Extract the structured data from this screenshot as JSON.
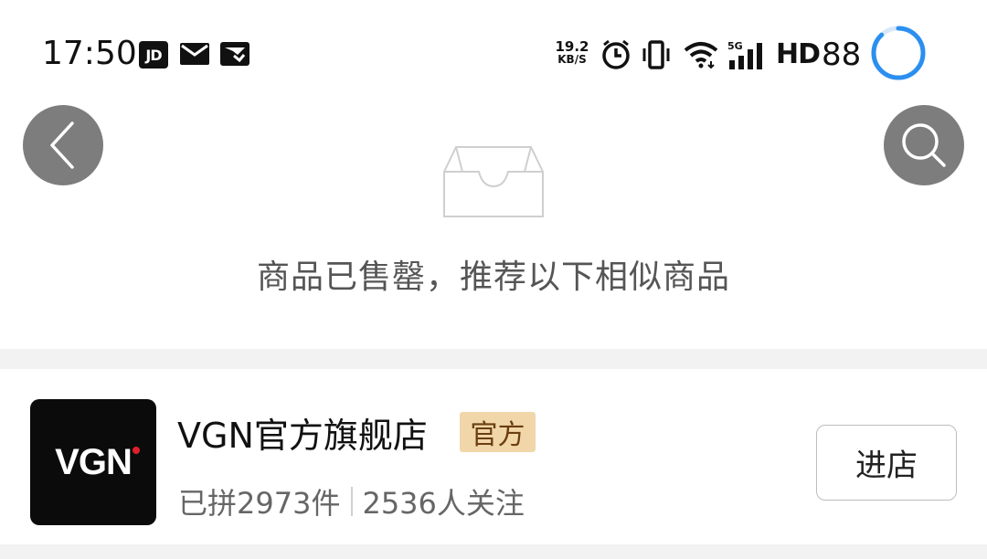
{
  "status_bar": {
    "time": "17:50",
    "jd_label": "JD",
    "net_speed_value": "19.2",
    "net_speed_unit": "KB/S",
    "network_type": "5G",
    "hd_label": "HD",
    "battery_level": "88",
    "battery_ring_fraction": 0.88,
    "icons": [
      "jd-app-icon",
      "mail-icon",
      "payment-icon",
      "alarm-icon",
      "vibrate-icon",
      "wifi-icon",
      "signal-icon"
    ]
  },
  "nav": {
    "back_icon": "chevron-left-icon",
    "search_icon": "search-icon"
  },
  "empty_state": {
    "icon": "empty-box-icon",
    "message": "商品已售罄，推荐以下相似商品"
  },
  "store": {
    "logo_text": "VGN",
    "name": "VGN官方旗舰店",
    "badge": "官方",
    "sold": "已拼2973件",
    "followers": "2536人关注",
    "enter_label": "进店"
  },
  "colors": {
    "nav_button_bg": "#7d7d7d",
    "badge_bg": "#f1d6aa",
    "badge_text": "#6a3f10",
    "battery_ring": "#2b8ff0",
    "logo_dot": "#e0202a",
    "divider": "#f2f2f2"
  }
}
